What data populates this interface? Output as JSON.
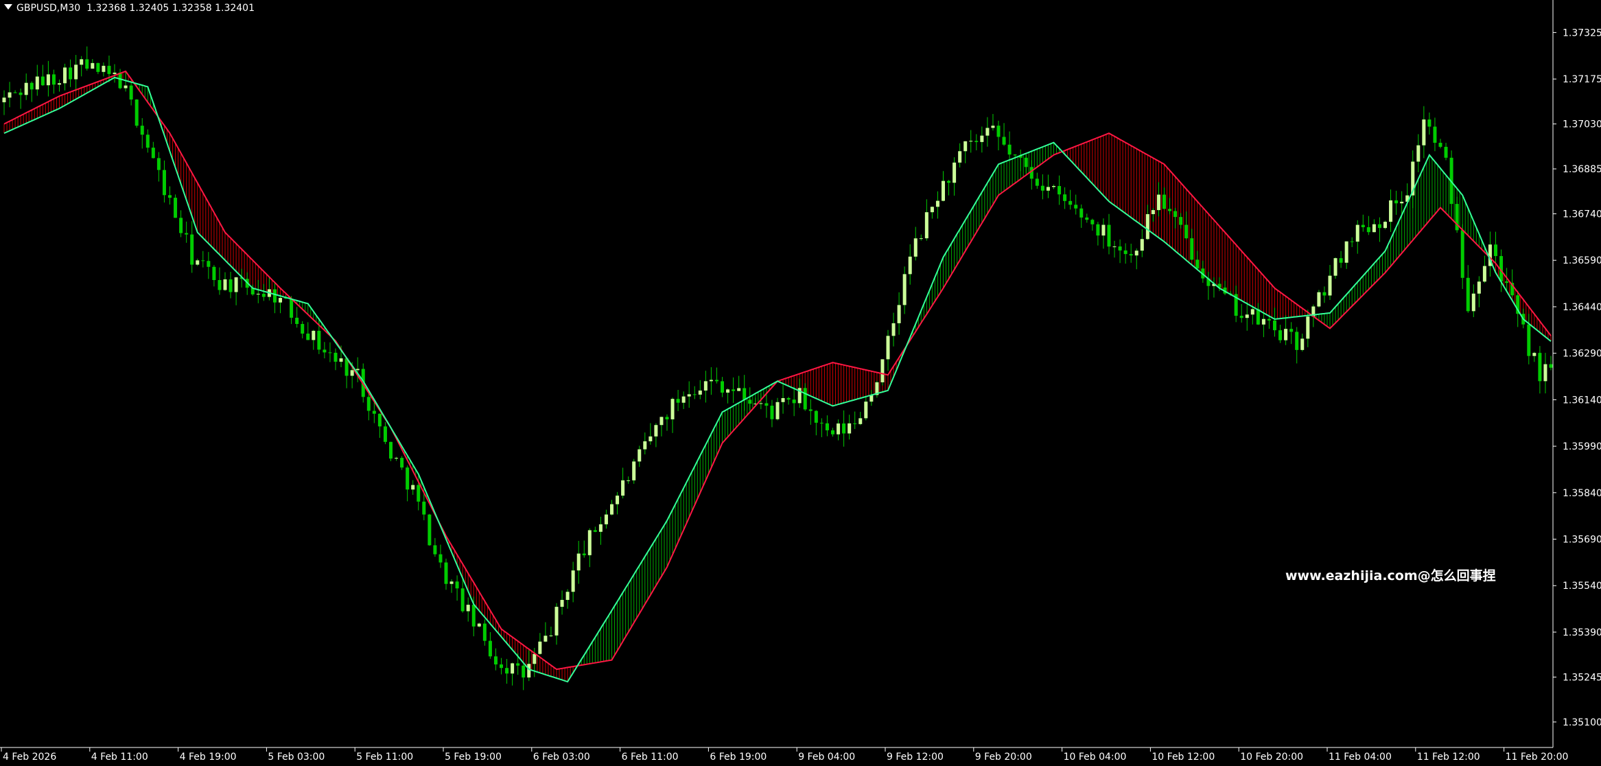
{
  "header": {
    "symbol": "GBPUSD,M30",
    "ohlc": "1.32368 1.32405 1.32358 1.32401"
  },
  "watermark": "www.eazhijia.com@怎么回事捏",
  "colors": {
    "background": "#000000",
    "bull_candle": "#ccff99",
    "bear_candle": "#00cc00",
    "fast_line": "#33ff99",
    "slow_line": "#ff1744",
    "up_fill": "#00aa00",
    "down_fill": "#cc0000",
    "axis": "#ffffff"
  },
  "chart_data": {
    "type": "candlestick",
    "title": "",
    "ylim": [
      1.3502,
      1.3743
    ],
    "y_ticks": [
      1.37325,
      1.37175,
      1.3703,
      1.36885,
      1.3674,
      1.3659,
      1.3644,
      1.3629,
      1.3614,
      1.3599,
      1.3584,
      1.3569,
      1.3554,
      1.3539,
      1.35245,
      1.351
    ],
    "y_tick_labels": [
      "1.37325",
      "1.37175",
      "1.37030",
      "1.36885",
      "1.36740",
      "1.36590",
      "1.36440",
      "1.36290",
      "1.36140",
      "1.35990",
      "1.35840",
      "1.35690",
      "1.35540",
      "1.35390",
      "1.35245",
      "1.35100"
    ],
    "x_tick_labels": [
      "4 Feb 2026",
      "4 Feb 11:00",
      "4 Feb 19:00",
      "5 Feb 03:00",
      "5 Feb 11:00",
      "5 Feb 19:00",
      "6 Feb 03:00",
      "6 Feb 11:00",
      "6 Feb 19:00",
      "9 Feb 04:00",
      "9 Feb 12:00",
      "9 Feb 20:00",
      "10 Feb 04:00",
      "10 Feb 12:00",
      "10 Feb 20:00",
      "11 Feb 04:00",
      "11 Feb 12:00",
      "11 Feb 20:00"
    ],
    "bars_per_x_tick": 16,
    "fast_line_name": "",
    "slow_line_name": "",
    "price_path": [
      [
        0,
        1.371
      ],
      [
        5,
        1.3715
      ],
      [
        10,
        1.3718
      ],
      [
        15,
        1.3722
      ],
      [
        22,
        1.3717
      ],
      [
        25,
        1.3705
      ],
      [
        30,
        1.3682
      ],
      [
        35,
        1.366
      ],
      [
        40,
        1.3652
      ],
      [
        45,
        1.365
      ],
      [
        50,
        1.3648
      ],
      [
        55,
        1.3638
      ],
      [
        60,
        1.3628
      ],
      [
        65,
        1.3622
      ],
      [
        70,
        1.36
      ],
      [
        75,
        1.3585
      ],
      [
        80,
        1.356
      ],
      [
        85,
        1.3545
      ],
      [
        90,
        1.353
      ],
      [
        95,
        1.3525
      ],
      [
        100,
        1.354
      ],
      [
        105,
        1.3563
      ],
      [
        110,
        1.3578
      ],
      [
        115,
        1.3592
      ],
      [
        120,
        1.3608
      ],
      [
        125,
        1.3618
      ],
      [
        130,
        1.362
      ],
      [
        135,
        1.3615
      ],
      [
        140,
        1.361
      ],
      [
        145,
        1.3615
      ],
      [
        150,
        1.3602
      ],
      [
        155,
        1.3606
      ],
      [
        160,
        1.3625
      ],
      [
        165,
        1.366
      ],
      [
        170,
        1.368
      ],
      [
        175,
        1.3695
      ],
      [
        180,
        1.37
      ],
      [
        185,
        1.369
      ],
      [
        190,
        1.3682
      ],
      [
        195,
        1.3675
      ],
      [
        200,
        1.3668
      ],
      [
        205,
        1.366
      ],
      [
        210,
        1.368
      ],
      [
        215,
        1.3665
      ],
      [
        220,
        1.365
      ],
      [
        225,
        1.3642
      ],
      [
        230,
        1.3638
      ],
      [
        235,
        1.3632
      ],
      [
        240,
        1.365
      ],
      [
        245,
        1.3668
      ],
      [
        250,
        1.3672
      ],
      [
        255,
        1.3682
      ],
      [
        258,
        1.3705
      ],
      [
        262,
        1.369
      ],
      [
        266,
        1.3645
      ],
      [
        270,
        1.3665
      ],
      [
        275,
        1.364
      ],
      [
        279,
        1.3622
      ],
      [
        282,
        1.3625
      ]
    ],
    "fast_line_path": [
      [
        0,
        1.37
      ],
      [
        10,
        1.3708
      ],
      [
        20,
        1.3718
      ],
      [
        26,
        1.3715
      ],
      [
        35,
        1.3668
      ],
      [
        45,
        1.365
      ],
      [
        55,
        1.3645
      ],
      [
        65,
        1.362
      ],
      [
        75,
        1.359
      ],
      [
        85,
        1.3548
      ],
      [
        95,
        1.3527
      ],
      [
        102,
        1.3523
      ],
      [
        110,
        1.3546
      ],
      [
        120,
        1.3575
      ],
      [
        130,
        1.361
      ],
      [
        140,
        1.362
      ],
      [
        150,
        1.3612
      ],
      [
        160,
        1.3617
      ],
      [
        170,
        1.366
      ],
      [
        180,
        1.369
      ],
      [
        190,
        1.3697
      ],
      [
        200,
        1.3678
      ],
      [
        210,
        1.3665
      ],
      [
        220,
        1.365
      ],
      [
        230,
        1.364
      ],
      [
        240,
        1.3642
      ],
      [
        250,
        1.3662
      ],
      [
        258,
        1.3693
      ],
      [
        264,
        1.368
      ],
      [
        270,
        1.3655
      ],
      [
        275,
        1.364
      ],
      [
        282,
        1.363
      ]
    ],
    "slow_line_path": [
      [
        0,
        1.3703
      ],
      [
        10,
        1.3712
      ],
      [
        22,
        1.372
      ],
      [
        30,
        1.37
      ],
      [
        40,
        1.3668
      ],
      [
        50,
        1.365
      ],
      [
        60,
        1.3633
      ],
      [
        70,
        1.3605
      ],
      [
        80,
        1.357
      ],
      [
        90,
        1.354
      ],
      [
        100,
        1.3527
      ],
      [
        110,
        1.353
      ],
      [
        120,
        1.356
      ],
      [
        130,
        1.36
      ],
      [
        140,
        1.362
      ],
      [
        150,
        1.3626
      ],
      [
        160,
        1.3622
      ],
      [
        170,
        1.365
      ],
      [
        180,
        1.368
      ],
      [
        190,
        1.3693
      ],
      [
        200,
        1.37
      ],
      [
        210,
        1.369
      ],
      [
        220,
        1.367
      ],
      [
        230,
        1.365
      ],
      [
        240,
        1.3637
      ],
      [
        250,
        1.3655
      ],
      [
        260,
        1.3676
      ],
      [
        270,
        1.3658
      ],
      [
        282,
        1.363
      ]
    ],
    "bar_count": 282
  }
}
